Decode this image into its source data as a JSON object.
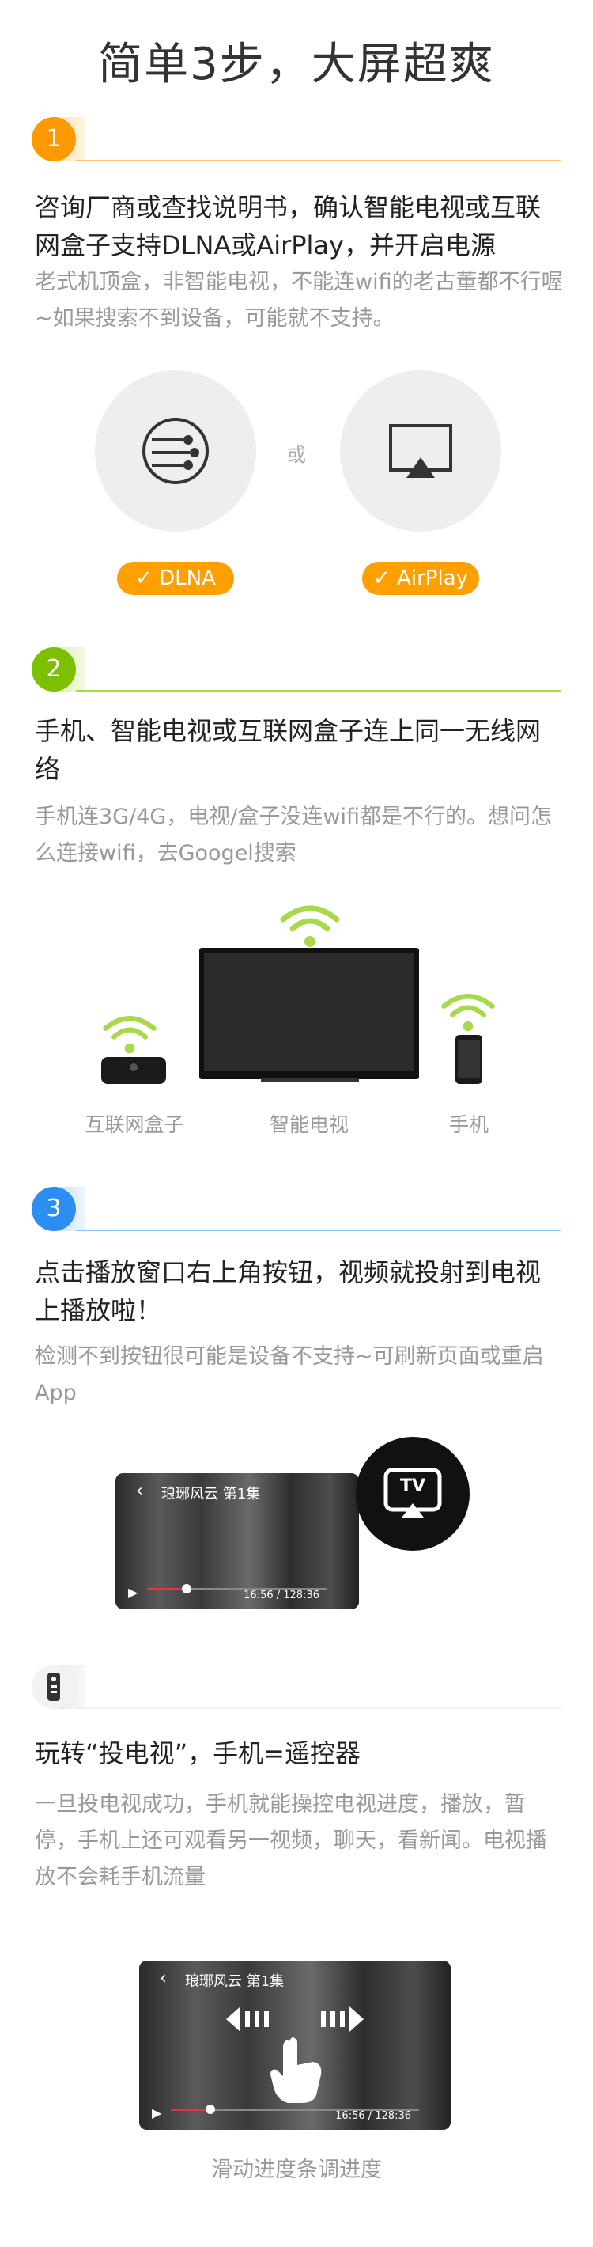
{
  "page_title": "简单3步，大屏超爽",
  "colors": {
    "step1": "#ff9900",
    "step2": "#7cc000",
    "step3": "#2b8ef0",
    "wifi": "#a8d94a",
    "pill": "#ff9f00"
  },
  "step1": {
    "number": "1",
    "heading": "咨询厂商或查找说明书，确认智能电视或互联网盒子支持DLNA或AirPlay，并开启电源",
    "desc": "老式机顶盒，非智能电视，不能连wifi的老古董都不行喔~如果搜索不到设备，可能就不支持。",
    "or_label": "或",
    "dlna_label": "DLNA",
    "airplay_label": "AirPlay",
    "check_icon": "check-icon"
  },
  "step2": {
    "number": "2",
    "heading": "手机、智能电视或互联网盒子连上同一无线网络",
    "desc": "手机连3G/4G，电视/盒子没连wifi都是不行的。想问怎么连接wifi，去Googel搜索",
    "devices": [
      "互联网盒子",
      "智能电视",
      "手机"
    ]
  },
  "step3": {
    "number": "3",
    "heading": "点击播放窗口右上角按钮，视频就投射到电视上播放啦！",
    "desc": "检测不到按钮很可能是设备不支持~可刷新页面或重启App",
    "video_title": "琅琊风云 第1集",
    "video_time": "16:56 / 128:36",
    "tv_button_label": "TV",
    "progress_fraction": 0.22
  },
  "step4": {
    "heading": "玩转“投电视”，手机=遥控器",
    "desc": "一旦投电视成功，手机就能操控电视进度，播放，暂停，手机上还可观看另一视频，聊天，看新闻。电视播放不会耗手机流量",
    "video_title": "琅琊风云 第1集",
    "video_time": "16:56 / 128:36",
    "progress_fraction": 0.16,
    "caption": "滑动进度条调进度"
  }
}
